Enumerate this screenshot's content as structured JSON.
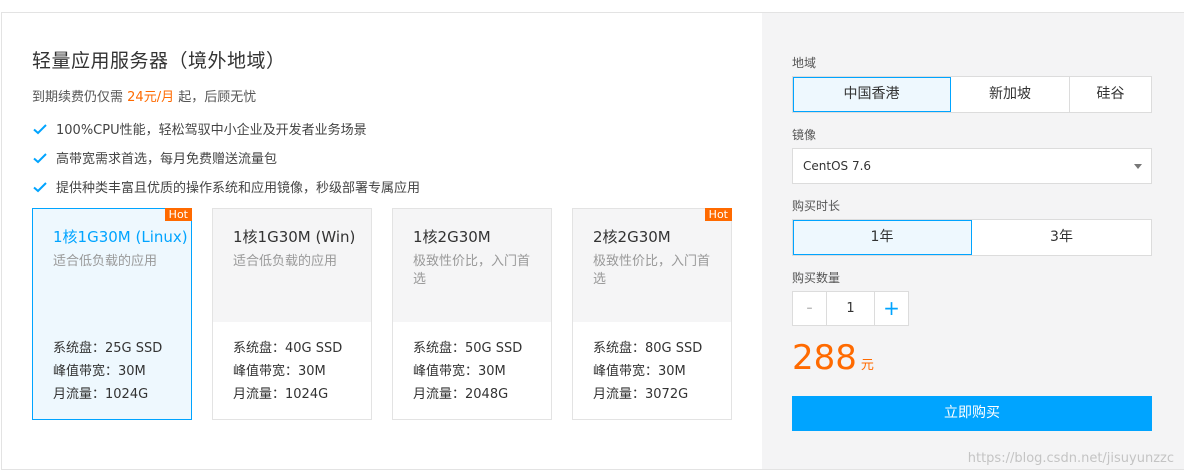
{
  "product": {
    "title": "轻量应用服务器（境外地域）",
    "subtitle_prefix": "到期续费仍仅需",
    "subtitle_price": "24元/月",
    "subtitle_suffix": "起，后顾无忧",
    "features": [
      "100%CPU性能，轻松驾驭中小企业及开发者业务场景",
      "高带宽需求首选，每月免费赠送流量包",
      "提供种类丰富且优质的操作系统和应用镜像，秒级部署专属应用"
    ]
  },
  "plans": [
    {
      "name": "1核1G30M (Linux)",
      "desc": "适合低负载的应用",
      "disk": "系统盘：25G SSD",
      "bandwidth": "峰值带宽：30M",
      "traffic": "月流量：1024G",
      "badge": "Hot",
      "selected": true
    },
    {
      "name": "1核1G30M (Win)",
      "desc": "适合低负载的应用",
      "disk": "系统盘：40G SSD",
      "bandwidth": "峰值带宽：30M",
      "traffic": "月流量：1024G",
      "badge": "",
      "selected": false
    },
    {
      "name": "1核2G30M",
      "desc": "极致性价比，入门首选",
      "disk": "系统盘：50G SSD",
      "bandwidth": "峰值带宽：30M",
      "traffic": "月流量：2048G",
      "badge": "",
      "selected": false
    },
    {
      "name": "2核2G30M",
      "desc": "极致性价比，入门首选",
      "disk": "系统盘：80G SSD",
      "bandwidth": "峰值带宽：30M",
      "traffic": "月流量：3072G",
      "badge": "Hot",
      "selected": false
    }
  ],
  "order": {
    "region_label": "地域",
    "regions": [
      "中国香港",
      "新加坡",
      "硅谷"
    ],
    "region_selected": "中国香港",
    "image_label": "镜像",
    "image_value": "CentOS 7.6",
    "duration_label": "购买时长",
    "durations": [
      "1年",
      "3年"
    ],
    "duration_selected": "1年",
    "quantity_label": "购买数量",
    "quantity_minus": "-",
    "quantity_value": "1",
    "quantity_plus": "+",
    "price": "288",
    "price_unit": "元",
    "buy_label": "立即购买"
  },
  "watermark": "https://blog.csdn.net/jisuyunzzc",
  "colors": {
    "accent": "#00a4ff",
    "price": "#ff6a00",
    "hot_badge": "#ff6a00",
    "right_panel_bg": "#f4f4f5"
  },
  "icons": {
    "feature_bullet": "check-icon",
    "select_caret": "caret-down-icon"
  }
}
